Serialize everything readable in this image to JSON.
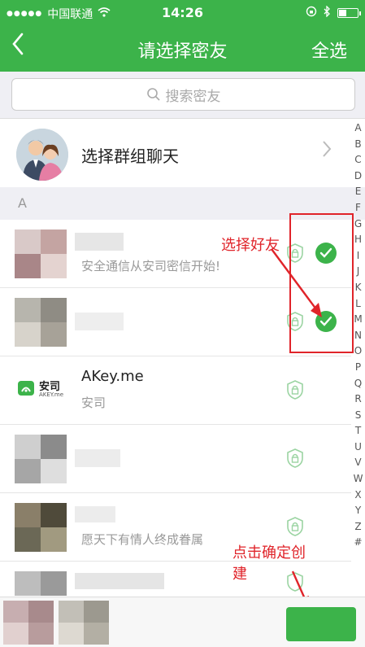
{
  "status": {
    "carrier": "中国联通",
    "time": "14:26",
    "battery_level": 0.45
  },
  "nav": {
    "back_icon": "chevron-left-icon",
    "title": "请选择密友",
    "select_all": "全选"
  },
  "search": {
    "placeholder": "搜索密友"
  },
  "group": {
    "label": "选择群组聊天"
  },
  "section_letter": "A",
  "contacts": [
    {
      "name": "",
      "subtitle": "安全通信从安司密信开始!",
      "selected": true
    },
    {
      "name": "",
      "subtitle": "",
      "selected": true
    },
    {
      "name": "AKey.me",
      "subtitle": "安司",
      "selected": false,
      "logo_text": "安司",
      "logo_sub": "AKEY.me"
    },
    {
      "name": "",
      "subtitle": "",
      "selected": false
    },
    {
      "name": "",
      "subtitle": "愿天下有情人终成眷属",
      "selected": false
    },
    {
      "name": "",
      "subtitle": "",
      "selected": false
    }
  ],
  "index_letters": [
    "A",
    "B",
    "C",
    "D",
    "E",
    "F",
    "G",
    "H",
    "I",
    "J",
    "K",
    "L",
    "M",
    "N",
    "O",
    "P",
    "Q",
    "R",
    "S",
    "T",
    "U",
    "V",
    "W",
    "X",
    "Y",
    "Z",
    "#"
  ],
  "annotations": {
    "select_friends": "选择好友",
    "click_confirm_line1": "点击确定创",
    "click_confirm_line2": "建"
  },
  "colors": {
    "brand_green": "#3cb34a",
    "annotation_red": "#e0242a"
  }
}
